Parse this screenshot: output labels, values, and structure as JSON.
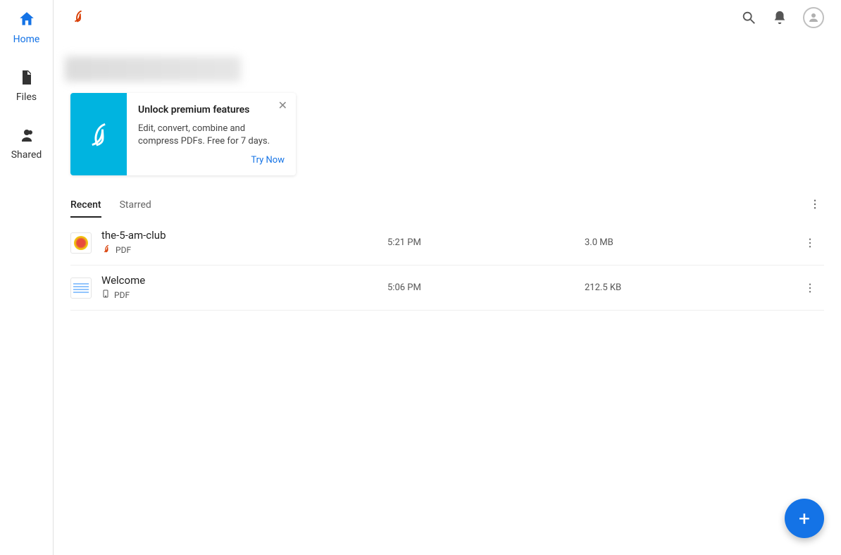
{
  "sidebar": {
    "items": [
      {
        "label": "Home",
        "active": true
      },
      {
        "label": "Files",
        "active": false
      },
      {
        "label": "Shared",
        "active": false
      }
    ]
  },
  "promo": {
    "title": "Unlock premium features",
    "description": "Edit, convert, combine and compress PDFs. Free for 7 days.",
    "cta": "Try Now"
  },
  "tabs": [
    {
      "label": "Recent",
      "active": true
    },
    {
      "label": "Starred",
      "active": false
    }
  ],
  "files": [
    {
      "name": "the-5-am-club",
      "type_label": "PDF",
      "time": "5:21 PM",
      "size": "3.0 MB",
      "source": "cloud"
    },
    {
      "name": "Welcome",
      "type_label": "PDF",
      "time": "5:06 PM",
      "size": "212.5 KB",
      "source": "device"
    }
  ],
  "fab": {
    "glyph": "+"
  }
}
